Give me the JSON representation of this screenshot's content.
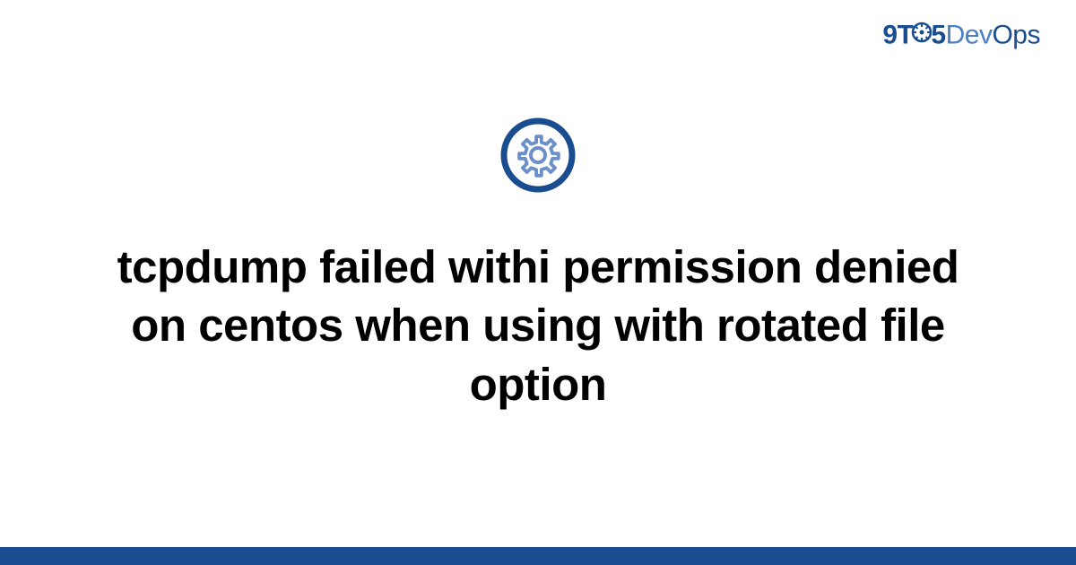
{
  "logo": {
    "prefix": "9T",
    "suffix": "5",
    "dev": "Dev",
    "ops": "Ops"
  },
  "title": "tcpdump failed withi permission denied on centos when using with rotated file option",
  "colors": {
    "brand_dark": "#1a4d8f",
    "brand_light": "#4a7fc4",
    "icon_ring": "#1a4d8f",
    "icon_gear": "#6b8fc9"
  }
}
